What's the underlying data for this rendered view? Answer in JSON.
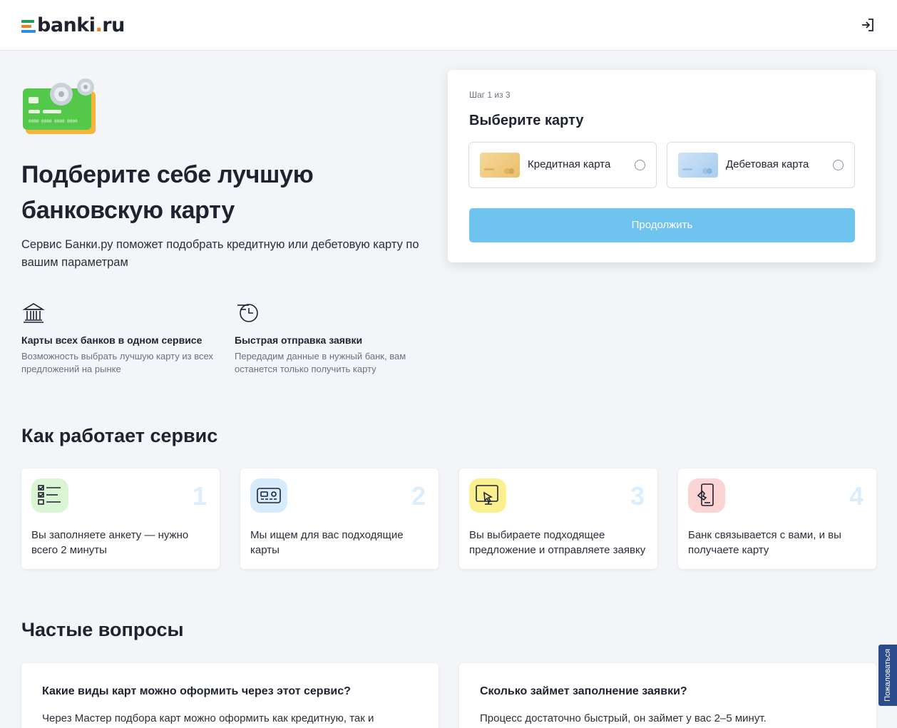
{
  "header": {
    "logo_main": "banki",
    "logo_dot": ".",
    "logo_tld": "ru",
    "login_icon": "login-icon"
  },
  "colors": {
    "accent": "#6ec3ef",
    "logo_bar_1": "#1a9e5b",
    "logo_bar_2": "#ef7f1a",
    "logo_bar_3": "#2c8de0"
  },
  "hero": {
    "title": "Подберите себе лучшую банковскую карту",
    "subtitle": "Сервис Банки.ру поможет подобрать кредитную или дебетовую карту по вашим параметрам",
    "features": [
      {
        "icon": "bank-icon",
        "title": "Карты всех банков в одном сервисе",
        "text": "Возможность выбрать лучшую карту из всех предложений на рынке"
      },
      {
        "icon": "fast-send-icon",
        "title": "Быстрая отправка заявки",
        "text": "Передадим данные в нужный банк, вам останется только получить карту"
      }
    ]
  },
  "picker": {
    "step": "Шаг 1 из 3",
    "title": "Выберите карту",
    "options": [
      {
        "label": "Кредитная карта",
        "selected": false
      },
      {
        "label": "Дебетовая карта",
        "selected": false
      }
    ],
    "continue_label": "Продолжить"
  },
  "how": {
    "title": "Как работает сервис",
    "steps": [
      {
        "num": "1",
        "icon": "checklist-icon",
        "text": "Вы заполняете анкету — нужно всего 2 минуты"
      },
      {
        "num": "2",
        "icon": "card-search-icon",
        "text": "Мы ищем для вас подходящие карты"
      },
      {
        "num": "3",
        "icon": "screen-tap-icon",
        "text": "Вы выбираете подходящее предложение и отправляете заявку"
      },
      {
        "num": "4",
        "icon": "phone-notify-icon",
        "text": "Банк связывается с вами, и вы получаете карту"
      }
    ]
  },
  "faq": {
    "title": "Частые вопросы",
    "items": [
      {
        "q": "Какие виды карт можно оформить через этот сервис?",
        "a": "Через Мастер подбора карт можно оформить как кредитную, так и"
      },
      {
        "q": "Сколько займет заполнение заявки?",
        "a": "Процесс достаточно быстрый, он займет у вас 2–5 минут."
      }
    ]
  },
  "complain_label": "Пожаловаться"
}
